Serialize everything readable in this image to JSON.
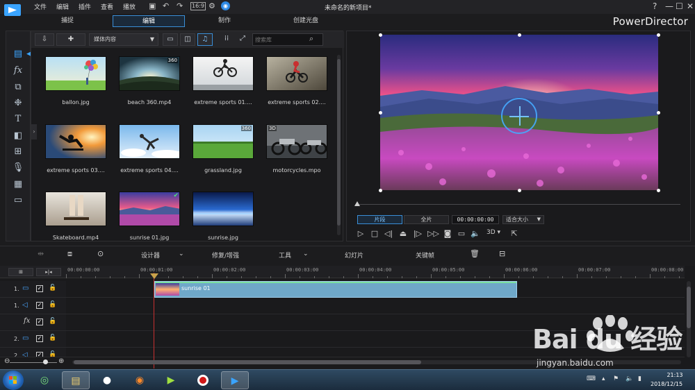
{
  "window": {
    "title": "未命名的新项目*",
    "brand": "PowerDirector",
    "menu": [
      "文件",
      "编辑",
      "插件",
      "查看",
      "播放"
    ],
    "controls": {
      "help": "?",
      "minimize": "—",
      "maximize": "☐",
      "close": "✕"
    }
  },
  "tabs": [
    {
      "label": "捕捉",
      "active": false
    },
    {
      "label": "编辑",
      "active": true
    },
    {
      "label": "制作",
      "active": false
    },
    {
      "label": "创建光盘",
      "active": false
    }
  ],
  "rail": [
    {
      "icon": "media-room-icon",
      "active": true
    },
    {
      "icon": "fx-room-icon"
    },
    {
      "icon": "pip-room-icon"
    },
    {
      "icon": "particle-room-icon"
    },
    {
      "icon": "title-room-icon"
    },
    {
      "icon": "transition-room-icon"
    },
    {
      "icon": "audio-mixing-icon"
    },
    {
      "icon": "voiceover-icon"
    },
    {
      "icon": "chapter-room-icon"
    },
    {
      "icon": "subtitle-room-icon"
    }
  ],
  "library": {
    "content_select": "媒体内容",
    "search_placeholder": "搜索库",
    "items": [
      {
        "label": "ballon.jpg",
        "badge": ""
      },
      {
        "label": "beach 360.mp4",
        "badge": "360"
      },
      {
        "label": "extreme sports 01....",
        "badge": ""
      },
      {
        "label": "extreme sports 02....",
        "badge": ""
      },
      {
        "label": "extreme sports 03....",
        "badge": ""
      },
      {
        "label": "extreme sports 04....",
        "badge": ""
      },
      {
        "label": "grassland.jpg",
        "badge": "360"
      },
      {
        "label": "motorcycles.mpo",
        "badge": "3D"
      },
      {
        "label": "Skateboard.mp4",
        "badge": ""
      },
      {
        "label": "sunrise 01.jpg",
        "badge": "check"
      },
      {
        "label": "sunrise.jpg",
        "badge": ""
      }
    ]
  },
  "preview": {
    "seg_clip": "片段",
    "seg_full": "全片",
    "timecode": "00:00:00:00",
    "fit": "适合大小",
    "three_d": "3D"
  },
  "timeline_toolbar": {
    "designer": "设计器",
    "fix_enhance": "修复/增强",
    "tools": "工具",
    "slideshow": "幻灯片",
    "keyframe": "关键帧"
  },
  "timeline": {
    "ruler": [
      "00:00:00:00",
      "00:00:01:00",
      "00:00:02:00",
      "00:00:03:00",
      "00:00:04:00",
      "00:00:05:00",
      "00:00:06:00",
      "00:00:07:00",
      "00:00:08:00"
    ],
    "tracks": [
      {
        "num": "1.",
        "type": "video"
      },
      {
        "num": "1.",
        "type": "audio"
      },
      {
        "num": "",
        "type": "fx"
      },
      {
        "num": "2.",
        "type": "video"
      },
      {
        "num": "2.",
        "type": "audio"
      }
    ],
    "clip_label": "sunrise 01"
  },
  "taskbar": {
    "time": "21:13",
    "date": "2018/12/15"
  },
  "watermark": {
    "main": "Bai du 经验",
    "url": "jingyan.baidu.com"
  }
}
